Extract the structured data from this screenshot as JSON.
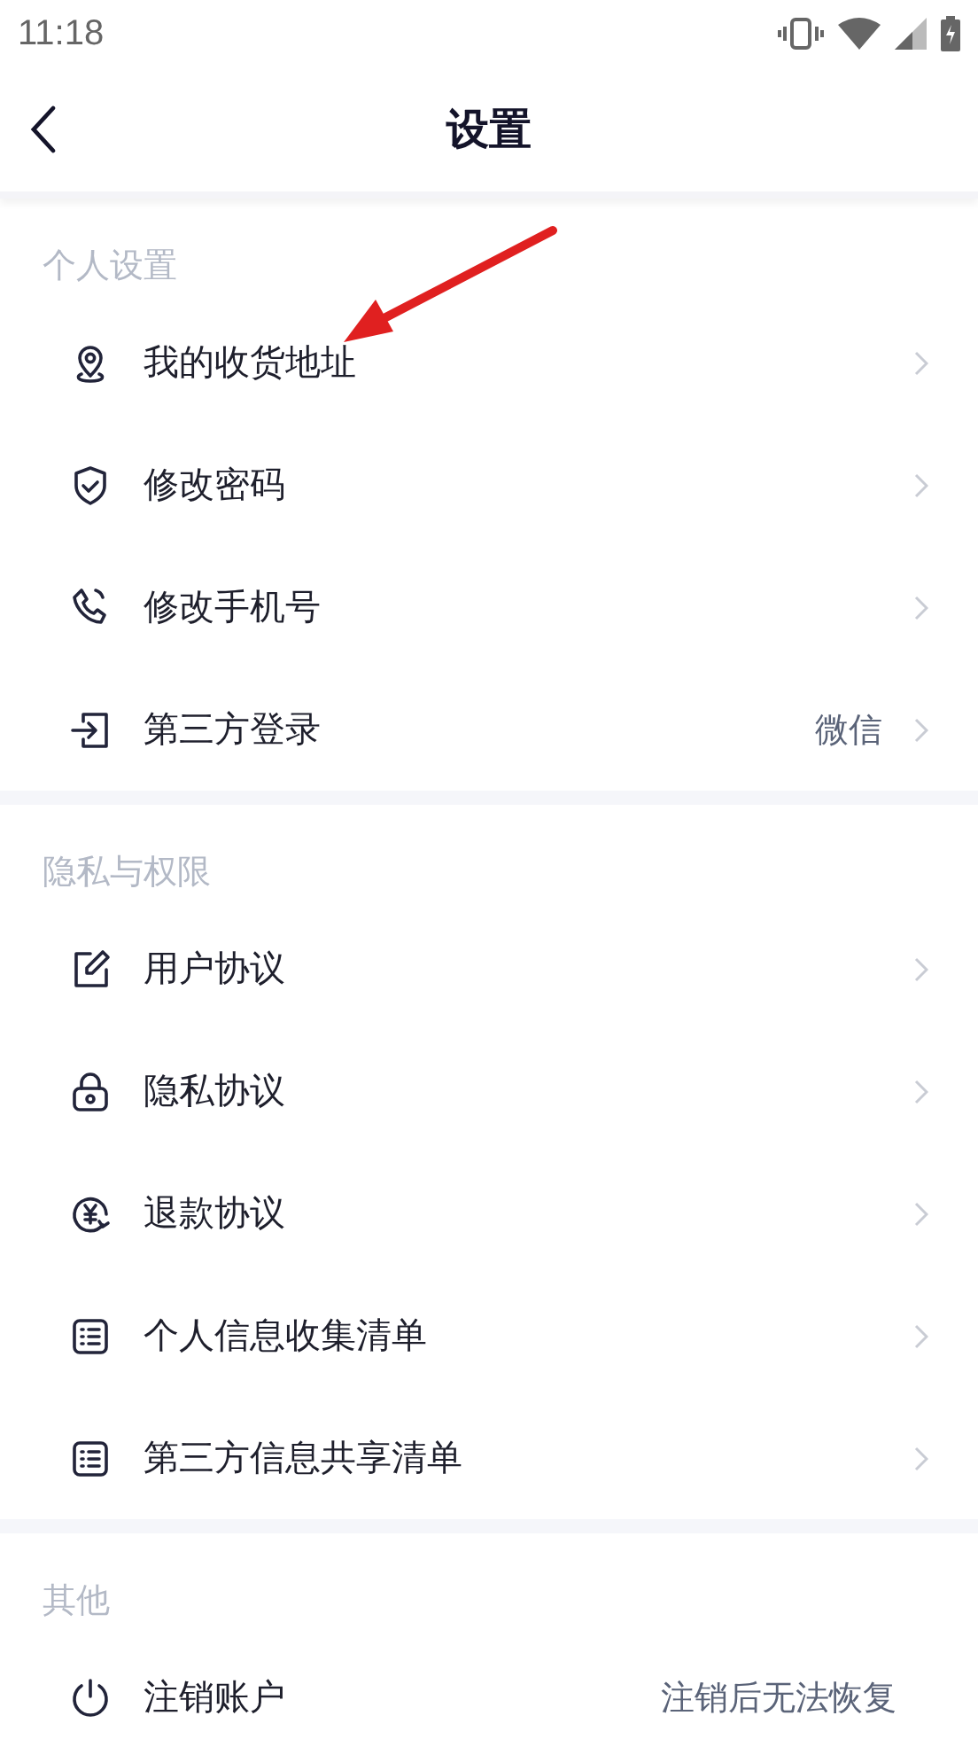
{
  "status_bar": {
    "time": "11:18"
  },
  "header": {
    "title": "设置"
  },
  "sections": [
    {
      "title": "个人设置",
      "items": [
        {
          "label": "我的收货地址",
          "chevron": true
        },
        {
          "label": "修改密码",
          "chevron": true
        },
        {
          "label": "修改手机号",
          "chevron": true
        },
        {
          "label": "第三方登录",
          "value": "微信",
          "chevron": true
        }
      ]
    },
    {
      "title": "隐私与权限",
      "items": [
        {
          "label": "用户协议",
          "chevron": true
        },
        {
          "label": "隐私协议",
          "chevron": true
        },
        {
          "label": "退款协议",
          "chevron": true
        },
        {
          "label": "个人信息收集清单",
          "chevron": true
        },
        {
          "label": "第三方信息共享清单",
          "chevron": true
        }
      ]
    },
    {
      "title": "其他",
      "items": [
        {
          "label": "注销账户",
          "value": "注销后无法恢复",
          "chevron": false
        }
      ]
    }
  ],
  "annotation": {
    "kind": "arrow"
  }
}
